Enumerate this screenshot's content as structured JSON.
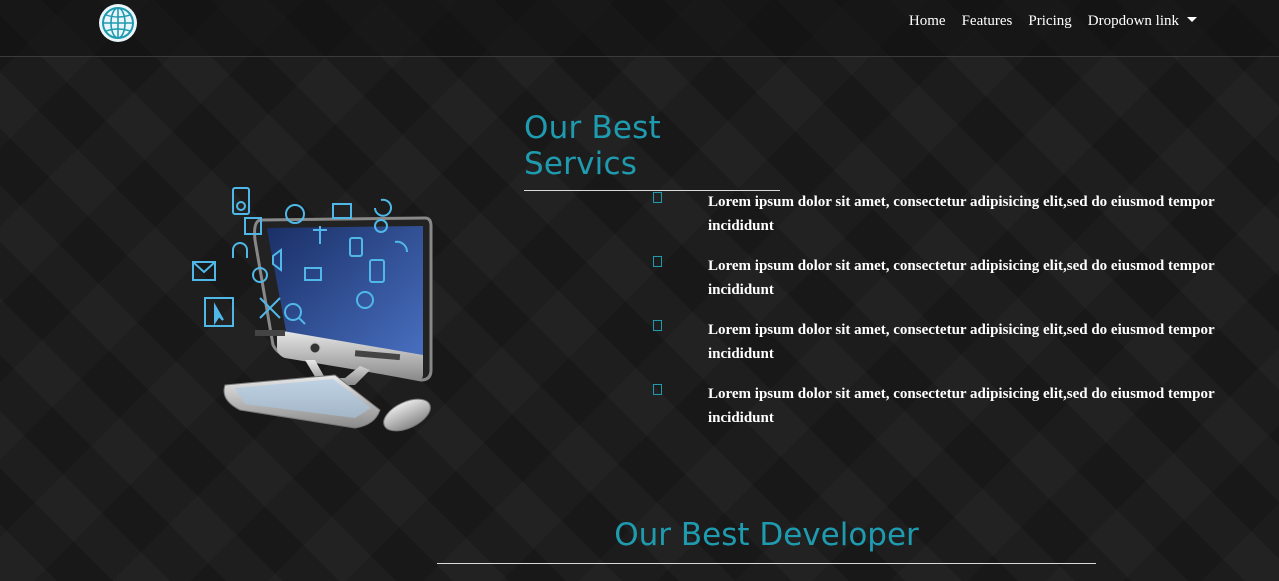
{
  "nav": {
    "brand_icon": "globe-icon",
    "links": [
      "Home",
      "Features",
      "Pricing",
      "Dropdown link"
    ]
  },
  "services": {
    "title": "Our Best Servics",
    "items": [
      "Lorem ipsum dolor sit amet, consectetur adipisicing elit,sed do eiusmod tempor incididunt",
      "Lorem ipsum dolor sit amet, consectetur adipisicing elit,sed do eiusmod tempor incididunt",
      "Lorem ipsum dolor sit amet, consectetur adipisicing elit,sed do eiusmod tempor incididunt",
      "Lorem ipsum dolor sit amet, consectetur adipisicing elit,sed do eiusmod tempor incididunt"
    ],
    "item_icon": "checkbox-icon",
    "illustration": "computer-apps-icon"
  },
  "developers": {
    "title": "Our Best Developer"
  },
  "colors": {
    "accent": "#1f9bb0",
    "background": "#1a1a1a",
    "text": "#ffffff"
  }
}
